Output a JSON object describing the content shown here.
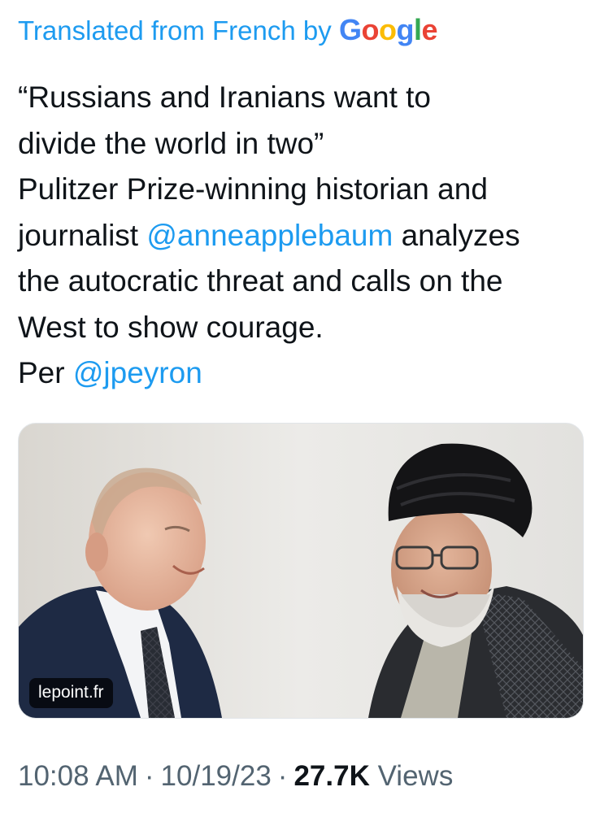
{
  "translation": {
    "label": "Translated from French by",
    "provider_letters": [
      "G",
      "o",
      "o",
      "g",
      "l",
      "e"
    ],
    "colors": {
      "blue": "#4285f4",
      "red": "#ea4335",
      "yellow": "#fbbc05",
      "green": "#34a853",
      "link": "#1d9bf0"
    }
  },
  "tweet": {
    "lines": {
      "l1": "“Russians and Iranians want to",
      "l2": "divide the world in two”",
      "l3": "Pulitzer Prize-winning historian and",
      "l4_prefix": "journalist ",
      "l4_mention": "@anneapplebaum",
      "l4_suffix": " analyzes",
      "l5": "the autocratic threat and calls on the",
      "l6": "West to show courage.",
      "l7_prefix": "Per ",
      "l7_mention": "@jpeyron"
    }
  },
  "media": {
    "source": "lepoint.fr"
  },
  "meta": {
    "time": "10:08 AM",
    "separator": "·",
    "date": "10/19/23",
    "views_count": "27.7K",
    "views_label": " Views"
  }
}
